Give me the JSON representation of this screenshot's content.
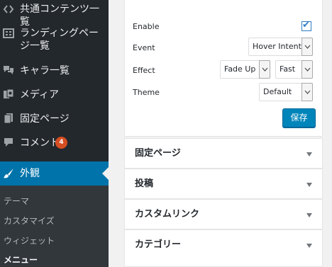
{
  "sidebar": {
    "items": [
      {
        "label": "共通コンテンツ一覧",
        "icon": "shortcode-icon"
      },
      {
        "label": "ランディングページ一覧",
        "icon": "grid-icon"
      },
      {
        "label": "キャラ一覧",
        "icon": "chat-bubbles-icon"
      },
      {
        "label": "メディア",
        "icon": "media-icon"
      },
      {
        "label": "固定ページ",
        "icon": "pages-icon"
      },
      {
        "label": "コメント",
        "icon": "comment-icon",
        "badge": "4"
      },
      {
        "label": "外観",
        "icon": "paintbrush-icon"
      }
    ],
    "submenu": [
      "テーマ",
      "カスタマイズ",
      "ウィジェット",
      "メニュー"
    ]
  },
  "settings": {
    "enable_label": "Enable",
    "enable_checked": true,
    "event_label": "Event",
    "event_value": "Hover Intent",
    "effect_label": "Effect",
    "effect_value": "Fade Up",
    "speed_value": "Fast",
    "theme_label": "Theme",
    "theme_value": "Default",
    "save_label": "保存"
  },
  "accordion": [
    "固定ページ",
    "投稿",
    "カスタムリンク",
    "カテゴリー"
  ],
  "colors": {
    "sidebar_bg": "#23282d",
    "submenu_bg": "#32373c",
    "accent": "#0073aa",
    "button": "#0085ba",
    "badge": "#d54e21"
  }
}
